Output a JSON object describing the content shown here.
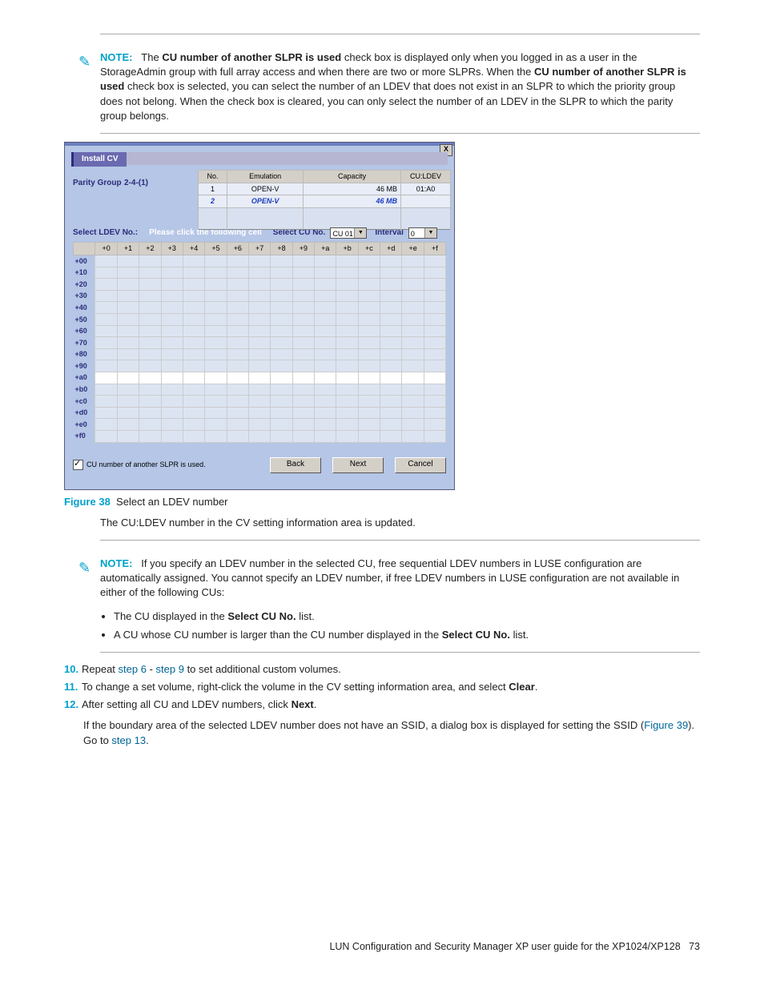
{
  "note_top": {
    "label": "NOTE:",
    "line1a": "The ",
    "bold1": "CU number of another SLPR is used",
    "line1b": " check box is displayed only when you logged in as a user in the StorageAdmin group with full array access and when there are two or more SLPRs. When the ",
    "bold2": "CU number of another SLPR is used",
    "line1c": " check box is selected, you can select the number of an LDEV that does not exist in an SLPR to which the priority group does not belong. When the check box is cleared, you can only select the number of an LDEV in the SLPR to which the parity group belongs."
  },
  "dialog": {
    "title": "Install CV",
    "close": "X",
    "parity_label": "Parity Group",
    "parity_value": "2-4-(1)",
    "table": {
      "headers": [
        "No.",
        "Emulation",
        "Capacity",
        "CU:LDEV"
      ],
      "rows": [
        {
          "no": "1",
          "emu": "OPEN-V",
          "cap": "46 MB",
          "cul": "01:A0"
        },
        {
          "no": "2",
          "emu": "OPEN-V",
          "cap": "46 MB",
          "cul": ""
        }
      ]
    },
    "select_ldev_label": "Select LDEV No.:",
    "please_click": "Please click the following cell",
    "select_cu_label": "Select CU No.",
    "cu_value": "CU 01",
    "interval_label": "Interval",
    "interval_value": "0",
    "grid": {
      "col_headers": [
        "+0",
        "+1",
        "+2",
        "+3",
        "+4",
        "+5",
        "+6",
        "+7",
        "+8",
        "+9",
        "+a",
        "+b",
        "+c",
        "+d",
        "+e",
        "+f"
      ],
      "row_headers": [
        "+00",
        "+10",
        "+20",
        "+30",
        "+40",
        "+50",
        "+60",
        "+70",
        "+80",
        "+90",
        "+a0",
        "+b0",
        "+c0",
        "+d0",
        "+e0",
        "+f0"
      ]
    },
    "checkbox_label": "CU number of another SLPR is used.",
    "btn_back": "Back",
    "btn_next": "Next",
    "btn_cancel": "Cancel"
  },
  "figure": {
    "label": "Figure 38",
    "caption": "Select an LDEV number"
  },
  "post_figure_text": "The CU:LDEV number in the CV setting information area is updated.",
  "note_mid": {
    "label": "NOTE:",
    "text": "If you specify an LDEV number in the selected CU, free sequential LDEV numbers in LUSE configuration are automatically assigned. You cannot specify an LDEV number, if free LDEV numbers in LUSE configuration are not available in either of the following CUs:",
    "bullet1a": "The CU displayed in the ",
    "bullet1b": "Select CU No.",
    "bullet1c": " list.",
    "bullet2a": "A CU whose CU number is larger than the CU number displayed in the ",
    "bullet2b": "Select CU No.",
    "bullet2c": " list."
  },
  "steps": {
    "s10_num": "10.",
    "s10a": "Repeat ",
    "s10_link1": "step 6",
    "s10_sep": " - ",
    "s10_link2": "step 9",
    "s10b": " to set additional custom volumes.",
    "s11_num": "11.",
    "s11a": "To change a set volume, right-click the volume in the CV setting information area, and select ",
    "s11_bold": "Clear",
    "s11b": ".",
    "s12_num": "12.",
    "s12a": "After setting all CU and LDEV numbers, click ",
    "s12_bold": "Next",
    "s12b": ".",
    "s12c": "If the boundary area of the selected LDEV number does not have an SSID, a dialog box is displayed for setting the SSID (",
    "s12_link1": "Figure 39",
    "s12d": "). Go to ",
    "s12_link2": "step 13",
    "s12e": "."
  },
  "footer": {
    "text": "LUN Configuration and Security Manager XP user guide for the XP1024/XP128",
    "page": "73"
  }
}
